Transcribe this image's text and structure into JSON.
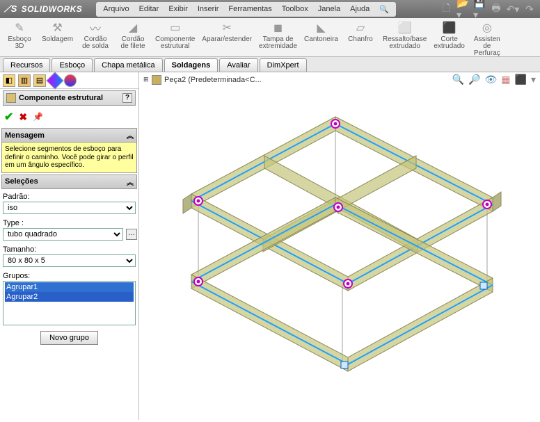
{
  "app": {
    "name": "SOLIDWORKS"
  },
  "menu": [
    "Arquivo",
    "Editar",
    "Exibir",
    "Inserir",
    "Ferramentas",
    "Toolbox",
    "Janela",
    "Ajuda"
  ],
  "ribbon": [
    {
      "label": "Esboço\n3D"
    },
    {
      "label": "Soldagem"
    },
    {
      "label": "Cordão\nde solda"
    },
    {
      "label": "Cordão\nde filete"
    },
    {
      "label": "Componente\nestrutural"
    },
    {
      "label": "Aparar/estender"
    },
    {
      "label": "Tampa de\nextremidade"
    },
    {
      "label": "Cantoneira"
    },
    {
      "label": "Chanfro"
    },
    {
      "label": "Ressalto/base\nextrudado"
    },
    {
      "label": "Corte\nextrudado"
    },
    {
      "label": "Assisten\nde\nPerfuraç"
    }
  ],
  "tabs": [
    {
      "label": "Recursos",
      "active": false
    },
    {
      "label": "Esboço",
      "active": false
    },
    {
      "label": "Chapa metálica",
      "active": false
    },
    {
      "label": "Soldagens",
      "active": true
    },
    {
      "label": "Avaliar",
      "active": false
    },
    {
      "label": "DimXpert",
      "active": false
    }
  ],
  "feature_tree": {
    "root": "Peça2  (Predeterminada<C..."
  },
  "panel": {
    "title": "Componente estrutural",
    "msg_hdr": "Mensagem",
    "msg_body": "Selecione segmentos de esboço para definir o caminho. Você pode girar o perfil em um ângulo específico.",
    "sel_hdr": "Seleções",
    "padrao_label": "Padrão:",
    "padrao_value": "iso",
    "type_label": "Type :",
    "type_value": "tubo quadrado",
    "tamanho_label": "Tamanho:",
    "tamanho_value": "80 x 80 x 5",
    "grupos_label": "Grupos:",
    "grupo_items": [
      "Agrupar1",
      "Agrupar2"
    ],
    "novo_grupo": "Novo grupo"
  },
  "view_icons": [
    "zoom-fit",
    "zoom-area",
    "eye",
    "section",
    "cube",
    "help"
  ]
}
